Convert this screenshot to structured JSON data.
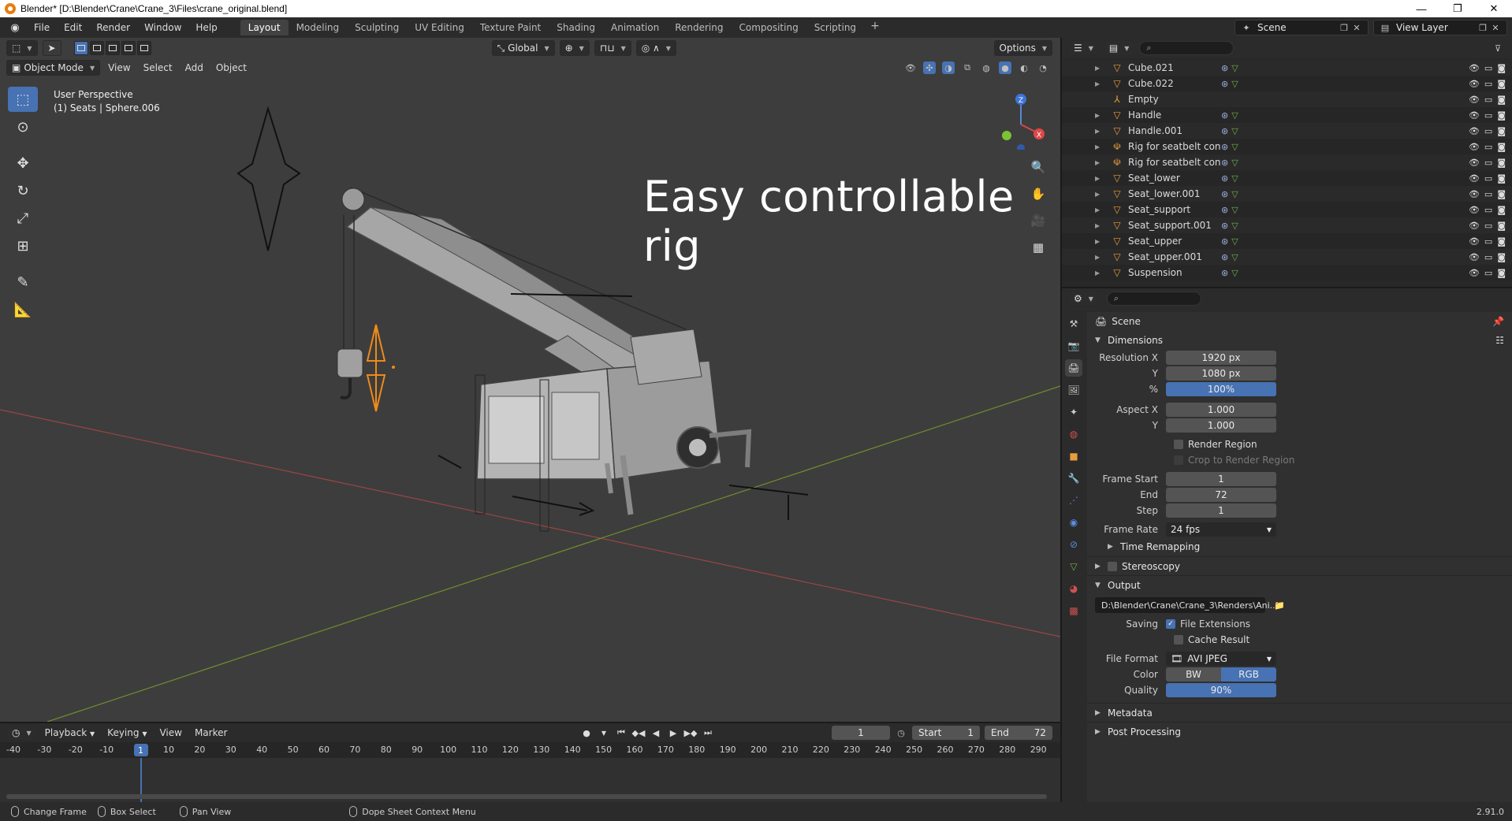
{
  "window": {
    "title": "Blender* [D:\\Blender\\Crane\\Crane_3\\Files\\crane_original.blend]",
    "minimize": "—",
    "maximize": "❐",
    "close": "✕"
  },
  "menubar": {
    "items": [
      "File",
      "Edit",
      "Render",
      "Window",
      "Help"
    ],
    "workspaces": [
      "Layout",
      "Modeling",
      "Sculpting",
      "UV Editing",
      "Texture Paint",
      "Shading",
      "Animation",
      "Rendering",
      "Compositing",
      "Scripting"
    ],
    "active_workspace": "Layout",
    "add_workspace": "+",
    "scene": "Scene",
    "view_layer": "View Layer"
  },
  "viewport": {
    "header": {
      "mode": "Object Mode",
      "menus": [
        "View",
        "Select",
        "Add",
        "Object"
      ],
      "transform_orientation": "Global",
      "options": "Options"
    },
    "info_line1": "User Perspective",
    "info_line2": "(1) Seats | Sphere.006",
    "overlay_text": "Easy controllable rig",
    "gizmo": {
      "z": "Z",
      "x": "X"
    }
  },
  "outliner": {
    "rows": [
      {
        "name": "Cube.021",
        "type": "mesh"
      },
      {
        "name": "Cube.022",
        "type": "mesh"
      },
      {
        "name": "Empty",
        "type": "empty"
      },
      {
        "name": "Handle",
        "type": "mesh"
      },
      {
        "name": "Handle.001",
        "type": "mesh"
      },
      {
        "name": "Rig for seatbelt contro",
        "type": "armature"
      },
      {
        "name": "Rig for seatbelt contro",
        "type": "armature"
      },
      {
        "name": "Seat_lower",
        "type": "mesh"
      },
      {
        "name": "Seat_lower.001",
        "type": "mesh"
      },
      {
        "name": "Seat_support",
        "type": "mesh"
      },
      {
        "name": "Seat_support.001",
        "type": "mesh"
      },
      {
        "name": "Seat_upper",
        "type": "mesh"
      },
      {
        "name": "Seat_upper.001",
        "type": "mesh"
      },
      {
        "name": "Suspension",
        "type": "mesh"
      }
    ]
  },
  "properties": {
    "context": "Scene",
    "dimensions": {
      "title": "Dimensions",
      "resolution_x_label": "Resolution X",
      "resolution_x": "1920 px",
      "y_label": "Y",
      "resolution_y": "1080 px",
      "percent_label": "%",
      "percent": "100%",
      "aspect_x_label": "Aspect X",
      "aspect_x": "1.000",
      "aspect_y": "1.000",
      "render_region": "Render Region",
      "crop_region": "Crop to Render Region",
      "frame_start_label": "Frame Start",
      "frame_start": "1",
      "end_label": "End",
      "frame_end": "72",
      "step_label": "Step",
      "frame_step": "1",
      "frame_rate_label": "Frame Rate",
      "frame_rate": "24 fps",
      "time_remapping": "Time Remapping"
    },
    "stereoscopy": "Stereoscopy",
    "output": {
      "title": "Output",
      "path": "D:\\Blender\\Crane\\Crane_3\\Renders\\Ani...",
      "saving_label": "Saving",
      "file_extensions": "File Extensions",
      "cache_result": "Cache Result",
      "file_format_label": "File Format",
      "file_format": "AVI JPEG",
      "color_label": "Color",
      "color_bw": "BW",
      "color_rgb": "RGB",
      "quality_label": "Quality",
      "quality": "90%"
    },
    "metadata": "Metadata",
    "post_processing": "Post Processing"
  },
  "timeline": {
    "menus": [
      "Playback",
      "Keying",
      "View",
      "Marker"
    ],
    "current_frame": "1",
    "start_label": "Start",
    "start": "1",
    "end_label": "End",
    "end": "72",
    "ticks": [
      "-40",
      "-30",
      "-20",
      "-10",
      "1",
      "10",
      "20",
      "30",
      "40",
      "50",
      "60",
      "70",
      "80",
      "90",
      "100",
      "110",
      "120",
      "130",
      "140",
      "150",
      "160",
      "170",
      "180",
      "190",
      "200",
      "210",
      "220",
      "230",
      "240",
      "250",
      "260",
      "270",
      "280",
      "290"
    ]
  },
  "statusbar": {
    "change_frame": "Change Frame",
    "box_select": "Box Select",
    "pan_view": "Pan View",
    "context_menu": "Dope Sheet Context Menu",
    "version": "2.91.0"
  }
}
